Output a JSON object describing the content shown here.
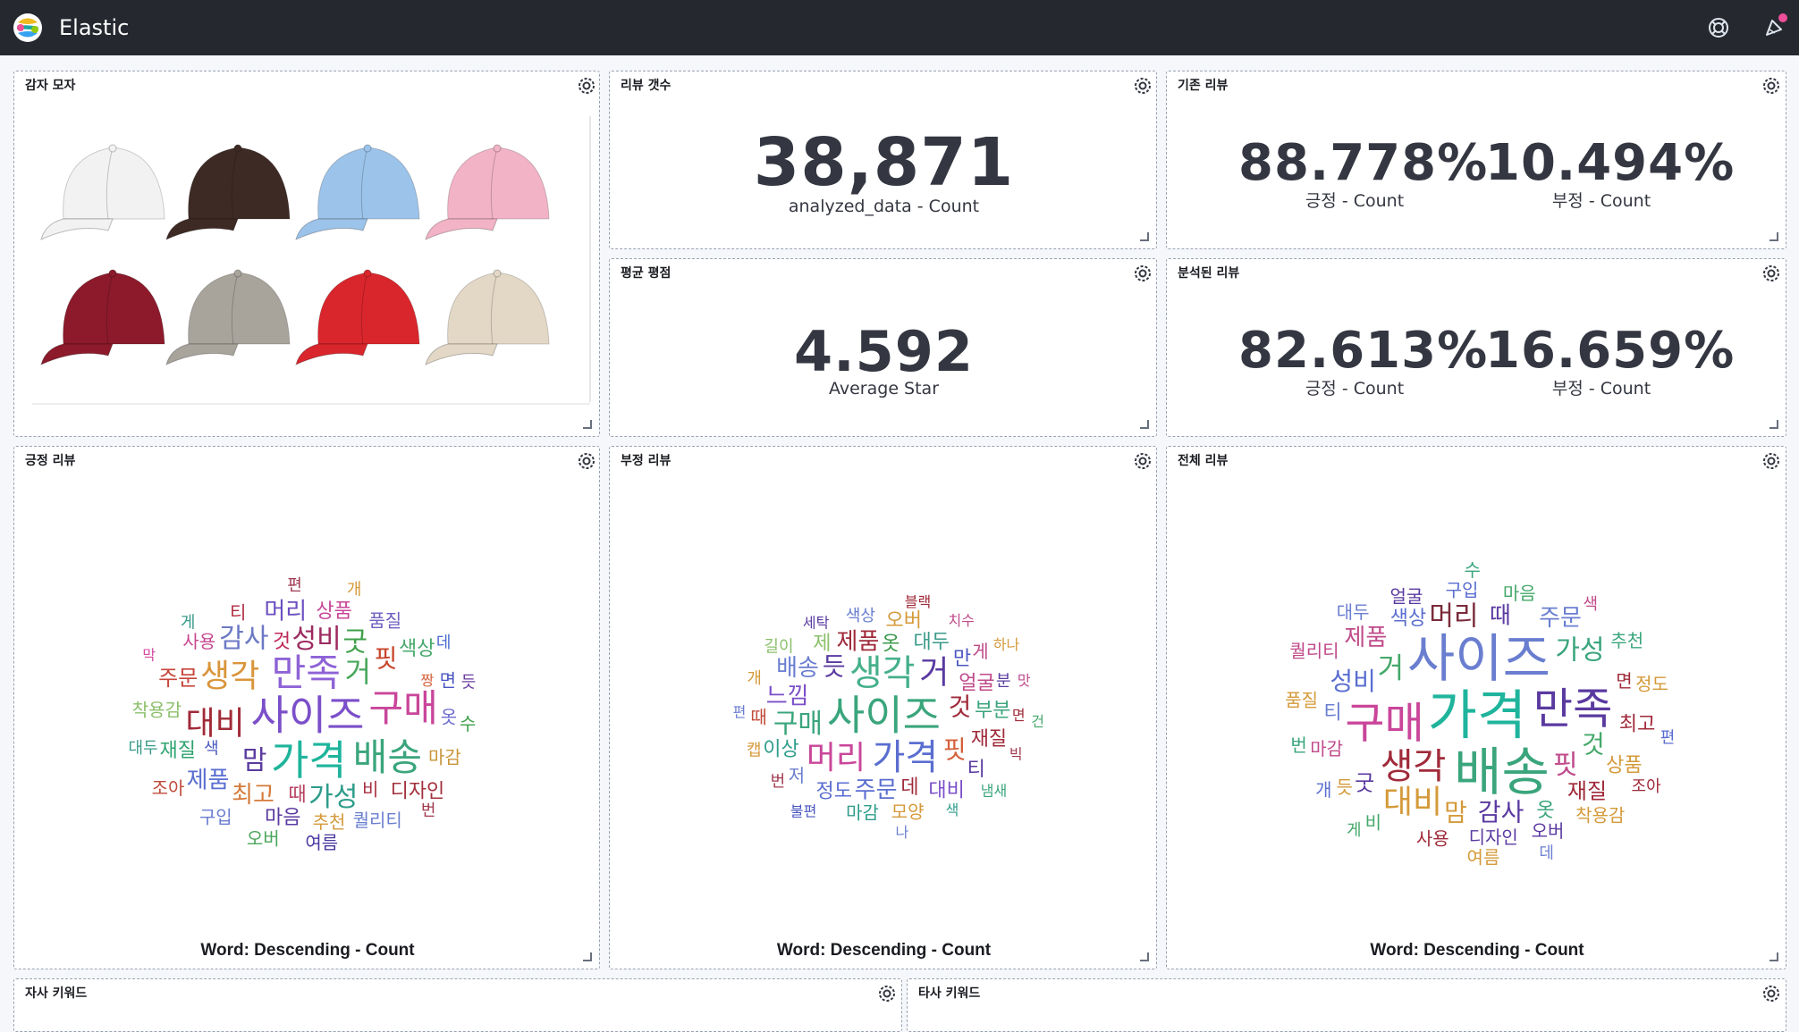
{
  "app": {
    "title": "Elastic"
  },
  "panels": {
    "hat": {
      "title": "감자 모자"
    },
    "review_count": {
      "title": "리뷰 갯수",
      "value": "38,871",
      "label": "analyzed_data - Count"
    },
    "existing": {
      "title": "기존 리뷰",
      "metrics": [
        {
          "value": "88.778%",
          "label": "긍정 - Count"
        },
        {
          "value": "10.494%",
          "label": "부정 - Count"
        }
      ]
    },
    "avg": {
      "title": "평균 평점",
      "value": "4.592",
      "label": "Average Star"
    },
    "analyzed": {
      "title": "분석된 리뷰",
      "metrics": [
        {
          "value": "82.613%",
          "label": "긍정 - Count"
        },
        {
          "value": "16.659%",
          "label": "부정 - Count"
        }
      ]
    },
    "positive": {
      "title": "긍정 리뷰",
      "cloud_label": "Word: Descending - Count"
    },
    "negative": {
      "title": "부정 리뷰",
      "cloud_label": "Word: Descending - Count"
    },
    "all": {
      "title": "전체 리뷰",
      "cloud_label": "Word: Descending - Count"
    },
    "own_keywords": {
      "title": "자사 키워드"
    },
    "other_keywords": {
      "title": "타사 키워드"
    }
  },
  "icons": {
    "logo": "elastic-logo-icon",
    "help": "help-lifebuoy-icon",
    "news": "newsfeed-icon",
    "gear": "gear-icon",
    "resize": "resize-handle-icon"
  },
  "colors": {
    "topbar": "#25282f",
    "news_badge": "#f04e98",
    "hat_colors": [
      "#f2f2f2",
      "#3e2a24",
      "#9cc3ea",
      "#f2b3c6",
      "#8c1a2b",
      "#a8a49c",
      "#d9262c",
      "#e3d8c6"
    ]
  },
  "word_clouds": {
    "positive": [
      [
        "사이즈",
        46,
        "#7b4fc9"
      ],
      [
        "가격",
        46,
        "#1fb49c"
      ],
      [
        "만족",
        42,
        "#8e63d6"
      ],
      [
        "구매",
        42,
        "#c9469a"
      ],
      [
        "배송",
        42,
        "#3aa57c"
      ],
      [
        "대비",
        36,
        "#a12a37"
      ],
      [
        "생각",
        36,
        "#d9953a"
      ],
      [
        "거",
        32,
        "#49a85d"
      ],
      [
        "맘",
        30,
        "#5b3ba0"
      ],
      [
        "성비",
        30,
        "#9c2a60"
      ],
      [
        "가성",
        30,
        "#2e9c8a"
      ],
      [
        "감사",
        30,
        "#6b78c4"
      ],
      [
        "굿",
        30,
        "#3fa04a"
      ],
      [
        "핏",
        28,
        "#c9452a"
      ],
      [
        "최고",
        26,
        "#d47a3a"
      ],
      [
        "제품",
        26,
        "#5a6ed0"
      ],
      [
        "머리",
        26,
        "#6b4fc0"
      ],
      [
        "주문",
        24,
        "#c7453a"
      ],
      [
        "마음",
        22,
        "#5a3aa0"
      ],
      [
        "재질",
        22,
        "#2ea36f"
      ],
      [
        "것",
        22,
        "#c02a5a"
      ],
      [
        "상품",
        22,
        "#c9469a"
      ],
      [
        "색상",
        22,
        "#45a86a"
      ],
      [
        "디자인",
        22,
        "#a3303d"
      ],
      [
        "때",
        22,
        "#b63f5f"
      ],
      [
        "추천",
        20,
        "#d49a3a"
      ],
      [
        "착용감",
        20,
        "#8bbf6a"
      ],
      [
        "사용",
        20,
        "#c74690"
      ],
      [
        "품질",
        20,
        "#7060c0"
      ],
      [
        "마감",
        20,
        "#c9953a"
      ],
      [
        "비",
        20,
        "#a83040"
      ],
      [
        "옷",
        20,
        "#6a6ad0"
      ],
      [
        "퀄리티",
        20,
        "#6a7ed0"
      ],
      [
        "면",
        20,
        "#4a56c0"
      ],
      [
        "티",
        20,
        "#b02a40"
      ],
      [
        "구입",
        20,
        "#6a7ed0"
      ],
      [
        "여름",
        20,
        "#4a3aa0"
      ],
      [
        "수",
        20,
        "#3fa04a"
      ],
      [
        "오버",
        20,
        "#4aa65a"
      ],
      [
        "조아",
        20,
        "#c04a3a"
      ],
      [
        "대두",
        18,
        "#3a9a8a"
      ],
      [
        "색",
        18,
        "#4a5ac0"
      ],
      [
        "데",
        18,
        "#4a6ad0"
      ],
      [
        "듯",
        18,
        "#6a3aa0"
      ],
      [
        "게",
        18,
        "#3a9a8a"
      ],
      [
        "편",
        18,
        "#a03a50"
      ],
      [
        "개",
        18,
        "#d49a3a"
      ],
      [
        "번",
        18,
        "#a03a50"
      ],
      [
        "짱",
        16,
        "#d4603a"
      ],
      [
        "막",
        16,
        "#d44aa0"
      ]
    ],
    "negative": [
      [
        "사이즈",
        46,
        "#3aa57c"
      ],
      [
        "생각",
        40,
        "#45b08a"
      ],
      [
        "가격",
        40,
        "#5a6ed0"
      ],
      [
        "머리",
        36,
        "#c9469a"
      ],
      [
        "거",
        36,
        "#5a3aa0"
      ],
      [
        "구매",
        30,
        "#3aa57c"
      ],
      [
        "것",
        28,
        "#a02a3a"
      ],
      [
        "듯",
        28,
        "#5a3aa0"
      ],
      [
        "핏",
        28,
        "#d4603a"
      ],
      [
        "주문",
        26,
        "#5a6ed0"
      ],
      [
        "느낌",
        26,
        "#7b4fc9"
      ],
      [
        "제품",
        26,
        "#a02a3a"
      ],
      [
        "배송",
        26,
        "#6a7ed0"
      ],
      [
        "얼굴",
        22,
        "#c04a8a"
      ],
      [
        "대두",
        22,
        "#3a9a8a"
      ],
      [
        "부분",
        22,
        "#3aa57c"
      ],
      [
        "재질",
        22,
        "#a02a3a"
      ],
      [
        "정도",
        22,
        "#5a6ed0"
      ],
      [
        "옷",
        22,
        "#3a9a4a"
      ],
      [
        "이상",
        22,
        "#2e9c8a"
      ],
      [
        "대비",
        22,
        "#7b4fc9"
      ],
      [
        "데",
        22,
        "#a02a3a"
      ],
      [
        "만",
        22,
        "#4a56c0"
      ],
      [
        "제",
        22,
        "#8bbf6a"
      ],
      [
        "티",
        22,
        "#5a3aa0"
      ],
      [
        "오버",
        22,
        "#d49a3a"
      ],
      [
        "모양",
        20,
        "#d49a3a"
      ],
      [
        "마감",
        20,
        "#2e9c8a"
      ],
      [
        "저",
        20,
        "#6a7ed0"
      ],
      [
        "때",
        20,
        "#c04a3a"
      ],
      [
        "게",
        20,
        "#c04a8a"
      ],
      [
        "분",
        18,
        "#5a3aa0"
      ],
      [
        "색상",
        18,
        "#6a7ed0"
      ],
      [
        "번",
        18,
        "#a03a50"
      ],
      [
        "캡",
        18,
        "#d49a3a"
      ],
      [
        "길이",
        18,
        "#8bbf6a"
      ],
      [
        "개",
        18,
        "#d49a3a"
      ],
      [
        "세탁",
        16,
        "#5a3aa0"
      ],
      [
        "면",
        16,
        "#a02a3a"
      ],
      [
        "빅",
        16,
        "#a03a50"
      ],
      [
        "색",
        16,
        "#2e9c8a"
      ],
      [
        "편",
        16,
        "#6a7ed0"
      ],
      [
        "치수",
        16,
        "#c04a8a"
      ],
      [
        "냄새",
        16,
        "#3aa57c"
      ],
      [
        "불편",
        16,
        "#4a56c0"
      ],
      [
        "블랙",
        16,
        "#a02a3a"
      ],
      [
        "하나",
        16,
        "#d49a3a"
      ],
      [
        "맛",
        16,
        "#c04a8a"
      ],
      [
        "건",
        16,
        "#45a86a"
      ],
      [
        "나",
        16,
        "#6a7ed0"
      ]
    ],
    "all": [
      [
        "가격",
        60,
        "#1fb49c"
      ],
      [
        "사이즈",
        58,
        "#6a7ed0"
      ],
      [
        "배송",
        58,
        "#3aa57c"
      ],
      [
        "구매",
        48,
        "#c9469a"
      ],
      [
        "만족",
        48,
        "#5a3aa0"
      ],
      [
        "생각",
        40,
        "#a02a3a"
      ],
      [
        "대비",
        36,
        "#d49a3a"
      ],
      [
        "거",
        32,
        "#45a86a"
      ],
      [
        "핏",
        30,
        "#c04a8a"
      ],
      [
        "머리",
        30,
        "#7a2a3a"
      ],
      [
        "가성",
        30,
        "#3aa57c"
      ],
      [
        "감사",
        28,
        "#5a3aa0"
      ],
      [
        "것",
        28,
        "#45a86a"
      ],
      [
        "성비",
        28,
        "#5a6ed0"
      ],
      [
        "맘",
        28,
        "#d49a3a"
      ],
      [
        "때",
        26,
        "#5a3aa0"
      ],
      [
        "제품",
        26,
        "#c04a8a"
      ],
      [
        "주문",
        26,
        "#6a7ed0"
      ],
      [
        "재질",
        24,
        "#a02a3a"
      ],
      [
        "굿",
        24,
        "#5a3aa0"
      ],
      [
        "옷",
        22,
        "#3aa57c"
      ],
      [
        "티",
        22,
        "#6a7ed0"
      ],
      [
        "색상",
        22,
        "#5a6ed0"
      ],
      [
        "최고",
        22,
        "#a02a3a"
      ],
      [
        "상품",
        22,
        "#d49a3a"
      ],
      [
        "디자인",
        20,
        "#5a3aa0"
      ],
      [
        "마감",
        20,
        "#c04a8a"
      ],
      [
        "면",
        20,
        "#a02a3a"
      ],
      [
        "구입",
        20,
        "#5a6ed0"
      ],
      [
        "마음",
        20,
        "#45a86a"
      ],
      [
        "오버",
        20,
        "#5a3aa0"
      ],
      [
        "듯",
        20,
        "#d49a3a"
      ],
      [
        "사용",
        20,
        "#a02a3a"
      ],
      [
        "얼굴",
        20,
        "#5a3aa0"
      ],
      [
        "품질",
        20,
        "#d49a3a"
      ],
      [
        "착용감",
        20,
        "#d49a3a"
      ],
      [
        "퀄리티",
        20,
        "#c04a8a"
      ],
      [
        "추천",
        20,
        "#3aa57c"
      ],
      [
        "정도",
        20,
        "#d49a3a"
      ],
      [
        "대두",
        20,
        "#6a7ed0"
      ],
      [
        "여름",
        20,
        "#d49a3a"
      ],
      [
        "비",
        20,
        "#45a86a"
      ],
      [
        "개",
        20,
        "#5a6ed0"
      ],
      [
        "번",
        20,
        "#3aa57c"
      ],
      [
        "수",
        20,
        "#3aa57c"
      ],
      [
        "조아",
        18,
        "#a02a3a"
      ],
      [
        "색",
        18,
        "#c04a8a"
      ],
      [
        "편",
        18,
        "#5a6ed0"
      ],
      [
        "데",
        18,
        "#6a7ed0"
      ],
      [
        "게",
        18,
        "#45a86a"
      ]
    ]
  }
}
